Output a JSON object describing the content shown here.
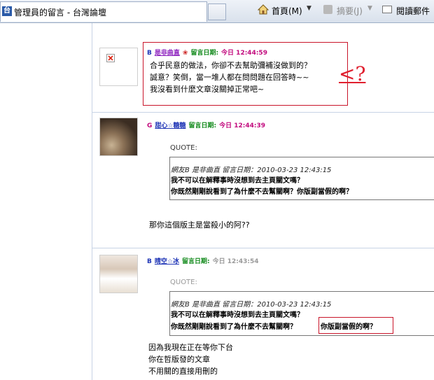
{
  "browser": {
    "tab_title": "管理員的留言 - 台灣論壇",
    "tab_icon_glyph": "台",
    "home_label": "首頁(M)",
    "feeds_label": "摘要(J)",
    "mail_label": "閱讀郵件"
  },
  "posts": [
    {
      "grade": "B",
      "user": "是非曲直",
      "date_label": "留言日期:",
      "date_value": "今日 12:44:59",
      "lines": [
        "合乎民意的做法，你卻不去幫助彌補沒做到的？",
        "誠意？笑倒，當一堆人都在問問題在回答時~~",
        "我沒看到什麼文章沒關掉正常吧~"
      ]
    },
    {
      "grade": "G",
      "user": "甜心☆糖糖",
      "date_label": "留言日期:",
      "date_value": "今日 12:44:39",
      "quote_label": "QUOTE:",
      "quote_meta": "網友B 是非曲直 留言日期：2010-03-23 12:43:15",
      "quote_lines": [
        "我不可以在解釋事時沒想到去主頁關文嗎？",
        "你既然剛剛說看到了為什麼不去幫關啊？你版副當假的啊？"
      ],
      "reply": "那你這個版主是當殺小的阿??"
    },
    {
      "grade": "B",
      "user": "晴空☆冰",
      "date_label": "留言日期:",
      "date_value": "今日 12:43:54",
      "quote_label": "QUOTE:",
      "quote_meta": "網友B 是非曲直 留言日期：2010-03-23 12:43:15",
      "quote_lines": [
        "我不可以在解釋事時沒想到去主頁關文嗎？",
        "你既然剛剛說看到了為什麼不去幫關啊？"
      ],
      "quote_highlight": "你版副當假的啊？",
      "reply_lines": [
        "因為我現在正在等你下台",
        "你在哲版發的文章",
        "不用關的直接用刪的"
      ]
    }
  ],
  "annotation": "<?",
  "colors": {
    "accent_red": "#c9152a",
    "username": "#8a1dbd",
    "date_label": "#138a1c",
    "date_value": "#c2097d",
    "grade": "#1f35b6"
  }
}
